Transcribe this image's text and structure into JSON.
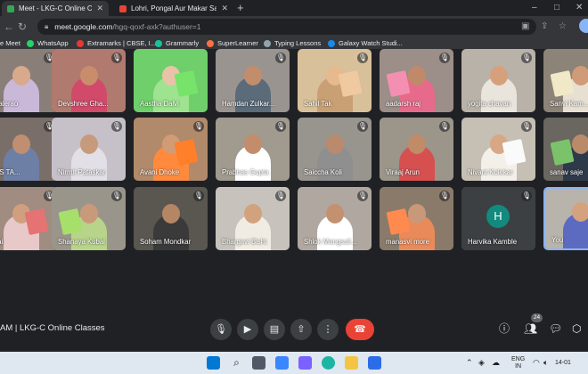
{
  "browser": {
    "tabs": [
      {
        "title": "Meet - LKG-C Online Classes",
        "active": true,
        "favicon_color": "#34a853"
      },
      {
        "title": "Lohri, Pongal Aur Makar Sankranti",
        "active": false,
        "favicon_color": "#ea4335"
      }
    ],
    "window_controls": {
      "minimize": "–",
      "maximize": "□",
      "close": "✕"
    },
    "address": {
      "host": "meet.google.com",
      "path": "/hgq-qoxf-axk?authuser=1"
    },
    "bookmarks": [
      {
        "label": "e Meet",
        "color": "#34a853"
      },
      {
        "label": "WhatsApp",
        "color": "#25d366"
      },
      {
        "label": "Extramarks | CBSE, I...",
        "color": "#e53935"
      },
      {
        "label": "Grammarly",
        "color": "#15c39a"
      },
      {
        "label": "SuperLearner",
        "color": "#ff7043"
      },
      {
        "label": "Typing Lessons",
        "color": "#90a4ae"
      },
      {
        "label": "Galaxy Watch Studi...",
        "color": "#1e88e5"
      }
    ]
  },
  "participants": [
    {
      "name": "Bhalerao",
      "bg": "#8a7f78",
      "skin": "#d8a98b",
      "shirt": "#c9b8d8",
      "muted": true,
      "paper": ""
    },
    {
      "name": "Devshree Gha...",
      "bg": "#b07a6e",
      "skin": "#c98d6c",
      "shirt": "#d24a6a",
      "muted": true,
      "paper": ""
    },
    {
      "name": "Aastha Dalvi",
      "bg": "#6fcf6b",
      "skin": "#e8c3a8",
      "shirt": "#9ee38f",
      "muted": false,
      "paper": "#78e36b"
    },
    {
      "name": "Hamdan Zulkar...",
      "bg": "#9a9490",
      "skin": "#c28d6b",
      "shirt": "#5b6b7a",
      "muted": true,
      "paper": ""
    },
    {
      "name": "Sahil Tak",
      "bg": "#d8c09a",
      "skin": "#e6b98e",
      "shirt": "#c9a074",
      "muted": true,
      "paper": "#f0c9a0"
    },
    {
      "name": "aadarsh raj",
      "bg": "#9c8e88",
      "skin": "#c08a6a",
      "shirt": "#e86a8a",
      "muted": true,
      "paper": "#f48fb1"
    },
    {
      "name": "yogita chavan",
      "bg": "#b9b2a8",
      "skin": "#d6a07c",
      "shirt": "#e9e4dc",
      "muted": true,
      "paper": ""
    },
    {
      "name": "Sanvi Kam...",
      "bg": "#8c8478",
      "skin": "#cf9b78",
      "shirt": "#e7e0d2",
      "muted": true,
      "paper": "#f1e8c8"
    },
    {
      "name": "AAS TA...",
      "bg": "#7a6e68",
      "skin": "#c08e70",
      "shirt": "#6e7fa6",
      "muted": true,
      "paper": ""
    },
    {
      "name": "Nirmit Pataskar",
      "bg": "#c6c0c8",
      "skin": "#c89a7c",
      "shirt": "#e2e0e6",
      "muted": true,
      "paper": ""
    },
    {
      "name": "Avani Dhoke",
      "bg": "#b08a6a",
      "skin": "#d19b76",
      "shirt": "#ff8a3d",
      "muted": true,
      "paper": "#ff7f2a"
    },
    {
      "name": "Prabhas Gupta",
      "bg": "#a19a8e",
      "skin": "#c38d6b",
      "shirt": "#ffffff",
      "muted": true,
      "paper": ""
    },
    {
      "name": "Saiccha Koli",
      "bg": "#98948e",
      "skin": "#b98a6e",
      "shirt": "#8f8f8f",
      "muted": true,
      "paper": ""
    },
    {
      "name": "Viraaj Arun",
      "bg": "#9b958a",
      "skin": "#c08c68",
      "shirt": "#d65050",
      "muted": true,
      "paper": ""
    },
    {
      "name": "Nivant Kolekar",
      "bg": "#c6bfb4",
      "skin": "#d7a786",
      "shirt": "#f3f0ea",
      "muted": true,
      "paper": "#fafafa"
    },
    {
      "name": "sanav saje",
      "bg": "#6a6660",
      "skin": "#b98b6b",
      "shirt": "#2e3a4a",
      "muted": true,
      "paper": "#7ac36b"
    },
    {
      "name": "esai",
      "bg": "#a08c80",
      "skin": "#cf9f80",
      "shirt": "#e8c8c8",
      "muted": true,
      "paper": "#e57373"
    },
    {
      "name": "Shanaya Kubal",
      "bg": "#9a958a",
      "skin": "#c99a7a",
      "shirt": "#b8d48a",
      "muted": true,
      "paper": "#a6e06a"
    },
    {
      "name": "Soham Mondkar",
      "bg": "#5a5650",
      "skin": "#b48664",
      "shirt": "#3a3a3a",
      "muted": true,
      "paper": ""
    },
    {
      "name": "Bhargavi Bisht",
      "bg": "#c7c3bc",
      "skin": "#d2a27e",
      "shirt": "#f0ece4",
      "muted": true,
      "paper": ""
    },
    {
      "name": "Shlok Mangsuli...",
      "bg": "#b0a8a0",
      "skin": "#c49170",
      "shirt": "#ffffff",
      "muted": true,
      "paper": ""
    },
    {
      "name": "manasvi more",
      "bg": "#8a7a6a",
      "skin": "#c99878",
      "shirt": "#e98a5a",
      "muted": true,
      "paper": "#ff8a50"
    },
    {
      "name": "Harvika Kamble",
      "bg": "#3c4043",
      "skin": "",
      "shirt": "",
      "muted": true,
      "paper": "",
      "initial": "H"
    },
    {
      "name": "You",
      "bg": "#b8b4ac",
      "skin": "#d4a27e",
      "shirt": "#5c6bc0",
      "muted": false,
      "paper": ""
    }
  ],
  "meeting": {
    "info": "AM | LKG-C Online Classes",
    "participant_count": "24",
    "end_icon": "phone-end-icon"
  },
  "taskbar": {
    "language": {
      "line1": "ENG",
      "line2": "IN"
    },
    "clock": "14-01"
  },
  "colors": {
    "accent": "#8ab4f8",
    "end_call": "#ea4335",
    "avatar_teal": "#128a7d"
  }
}
